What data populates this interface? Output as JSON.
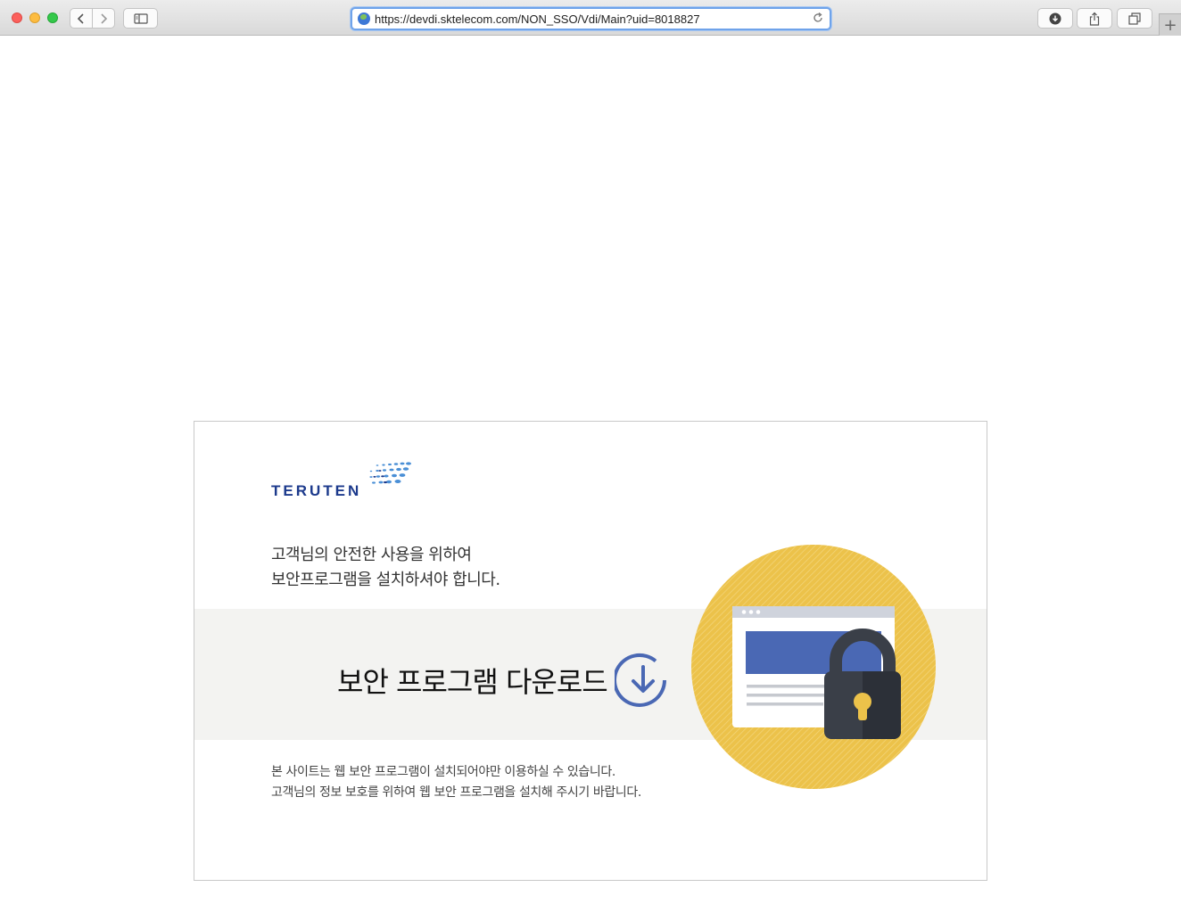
{
  "browser": {
    "url": "https://devdi.sktelecom.com/NON_SSO/Vdi/Main?uid=8018827",
    "new_tab_symbol": "+"
  },
  "page": {
    "logo_text": "TERUTEN",
    "intro_line1": "고객님의 안전한 사용을 위하여",
    "intro_line2": "보안프로그램을 설치하셔야 합니다.",
    "download_label": "보안 프로그램 다운로드",
    "note_line1": "본 사이트는 웹 보안 프로그램이 설치되어야만 이용하실 수 있습니다.",
    "note_line2": "고객님의 정보 보호를 위하여 웹 보안 프로그램을 설치해 주시기 바랍니다."
  },
  "colors": {
    "brand_blue": "#1c3a8c",
    "accent_blue": "#4a68b4",
    "circle_yellow": "#ecc24a",
    "band_gray": "#f3f3f1",
    "lock_dark": "#3a3f48"
  },
  "icons": [
    "search-icon",
    "back-icon",
    "forward-icon",
    "sidebar-icon",
    "globe-icon",
    "reload-icon",
    "download-icon",
    "share-icon",
    "tabs-icon",
    "lock-icon"
  ]
}
